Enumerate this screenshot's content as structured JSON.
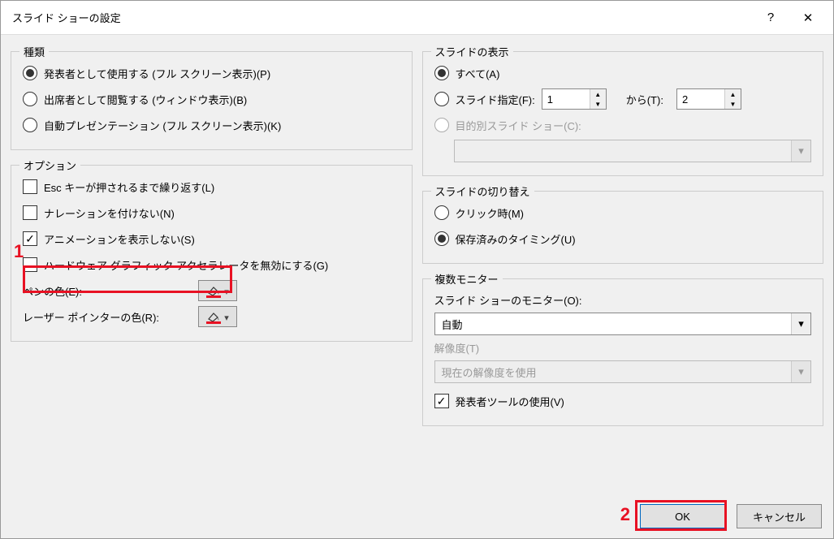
{
  "titlebar": {
    "title": "スライド ショーの設定",
    "help_label": "?",
    "close_label": "✕"
  },
  "groups": {
    "type": {
      "legend": "種類",
      "radio1": "発表者として使用する (フル スクリーン表示)(P)",
      "radio2": "出席者として閲覧する (ウィンドウ表示)(B)",
      "radio3": "自動プレゼンテーション (フル スクリーン表示)(K)"
    },
    "options": {
      "legend": "オプション",
      "chk1": "Esc キーが押されるまで繰り返す(L)",
      "chk2": "ナレーションを付けない(N)",
      "chk3": "アニメーションを表示しない(S)",
      "chk4": "ハードウェア グラフィック アクセラレータを無効にする(G)",
      "pen_label": "ペンの色(E):",
      "laser_label": "レーザー ポインターの色(R):"
    },
    "slides": {
      "legend": "スライドの表示",
      "all": "すべて(A)",
      "range": "スライド指定(F):",
      "from_val": "1",
      "to_label": "から(T):",
      "to_val": "2",
      "custom": "目的別スライド ショー(C):"
    },
    "advance": {
      "legend": "スライドの切り替え",
      "click": "クリック時(M)",
      "timing": "保存済みのタイミング(U)"
    },
    "monitors": {
      "legend": "複数モニター",
      "monitor_label": "スライド ショーのモニター(O):",
      "monitor_val": "自動",
      "res_label": "解像度(T)",
      "res_val": "現在の解像度を使用",
      "presenter": "発表者ツールの使用(V)"
    }
  },
  "buttons": {
    "ok": "OK",
    "cancel": "キャンセル"
  },
  "annotations": {
    "one": "1",
    "two": "2"
  }
}
